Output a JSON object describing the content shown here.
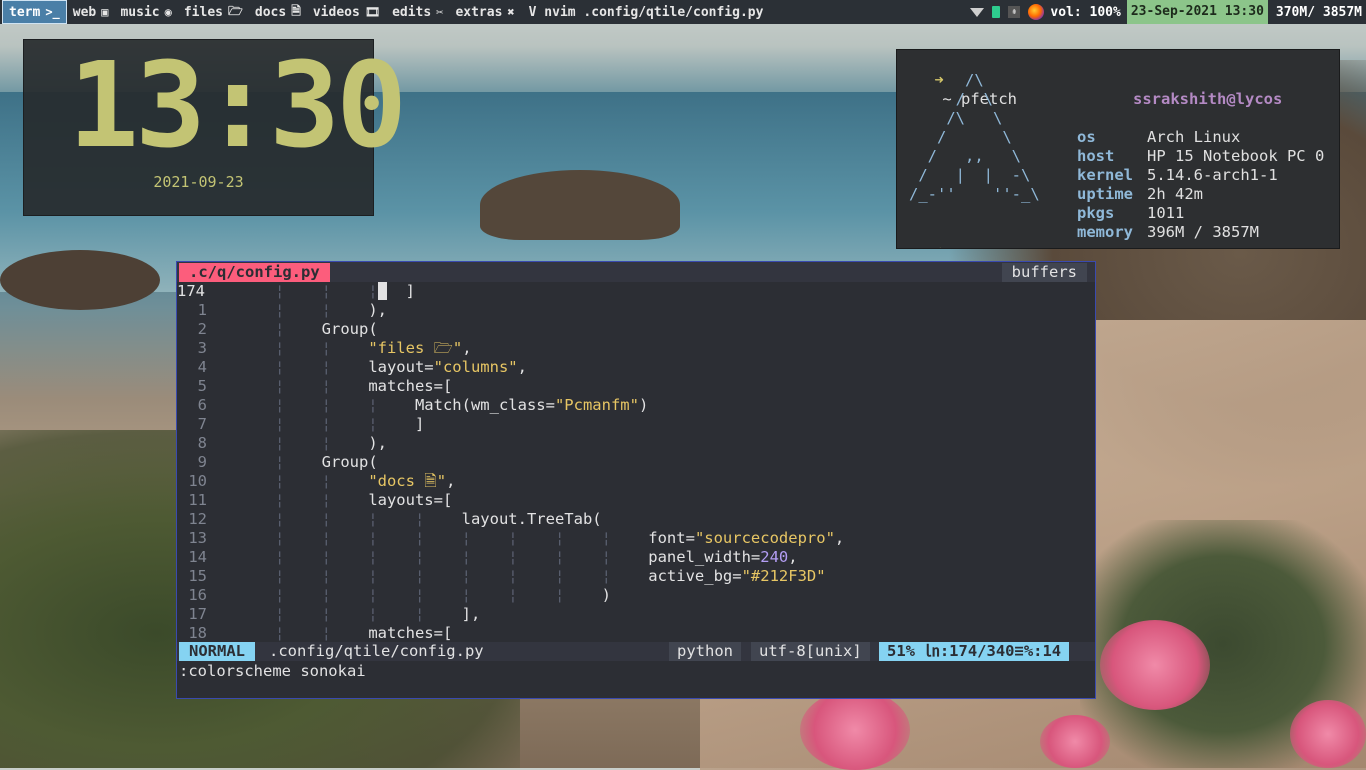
{
  "topbar": {
    "groups": [
      {
        "label": "term",
        "icon": ">_",
        "icon_name": "terminal-icon",
        "active": true
      },
      {
        "label": "web",
        "icon": "▣",
        "icon_name": "browser-icon"
      },
      {
        "label": "music",
        "icon": "◉",
        "icon_name": "music-icon"
      },
      {
        "label": "files",
        "icon": "🗁",
        "icon_name": "folder-icon"
      },
      {
        "label": "docs",
        "icon": "🗎",
        "icon_name": "document-icon"
      },
      {
        "label": "videos",
        "icon": "🎞",
        "icon_name": "film-icon"
      },
      {
        "label": "edits",
        "icon": "✂",
        "icon_name": "scissors-icon"
      },
      {
        "label": "extras",
        "icon": "✖",
        "icon_name": "tools-icon"
      }
    ],
    "window_title": "V nvim .config/qtile/config.py",
    "volume": "vol: 100%",
    "datetime": "23-Sep-2021 13:30",
    "memory": "370M/ 3857M",
    "update_icon": "⇞"
  },
  "clock": {
    "time": "13:30",
    "date": "2021-09-23"
  },
  "pfetch": {
    "prompt_arrow": "➜",
    "prompt": "~ pfetch",
    "prompt2": "~",
    "ascii": [
      "      /\\",
      "     /  \\",
      "    /\\   \\",
      "   /      \\",
      "  /   ,,   \\",
      " /   |  |  -\\",
      "/_-''    ''-_\\"
    ],
    "user": "ssrakshith@lycos",
    "info": [
      {
        "key": "os",
        "value": "Arch Linux"
      },
      {
        "key": "host",
        "value": "HP 15 Notebook PC 0"
      },
      {
        "key": "kernel",
        "value": "5.14.6-arch1-1"
      },
      {
        "key": "uptime",
        "value": "2h 42m"
      },
      {
        "key": "pkgs",
        "value": "1011"
      },
      {
        "key": "memory",
        "value": "396M / 3857M"
      }
    ]
  },
  "nvim": {
    "tab_label": ".c/q/config.py",
    "buffers_label": "buffers",
    "lines": [
      {
        "n": "174",
        "current": true,
        "segs": [
          {
            "t": "      ¦    ¦    ¦",
            "c": "guide"
          },
          {
            "t": " ",
            "c": "cursor"
          },
          {
            "t": "  ]",
            "c": ""
          }
        ]
      },
      {
        "n": "1",
        "segs": [
          {
            "t": "      ¦    ¦    ",
            "c": "guide"
          },
          {
            "t": "),",
            "c": ""
          }
        ]
      },
      {
        "n": "2",
        "segs": [
          {
            "t": "      ¦    ",
            "c": "guide"
          },
          {
            "t": "Group(",
            "c": ""
          }
        ]
      },
      {
        "n": "3",
        "segs": [
          {
            "t": "      ¦    ¦    ",
            "c": "guide"
          },
          {
            "t": "\"files 🗁\"",
            "c": "str"
          },
          {
            "t": ",",
            "c": ""
          }
        ]
      },
      {
        "n": "4",
        "segs": [
          {
            "t": "      ¦    ¦    ",
            "c": "guide"
          },
          {
            "t": "layout=",
            "c": ""
          },
          {
            "t": "\"columns\"",
            "c": "str"
          },
          {
            "t": ",",
            "c": ""
          }
        ]
      },
      {
        "n": "5",
        "segs": [
          {
            "t": "      ¦    ¦    ",
            "c": "guide"
          },
          {
            "t": "matches=[",
            "c": ""
          }
        ]
      },
      {
        "n": "6",
        "segs": [
          {
            "t": "      ¦    ¦    ¦    ",
            "c": "guide"
          },
          {
            "t": "Match(wm_class=",
            "c": ""
          },
          {
            "t": "\"Pcmanfm\"",
            "c": "str"
          },
          {
            "t": ")",
            "c": ""
          }
        ]
      },
      {
        "n": "7",
        "segs": [
          {
            "t": "      ¦    ¦    ¦    ",
            "c": "guide"
          },
          {
            "t": "]",
            "c": ""
          }
        ]
      },
      {
        "n": "8",
        "segs": [
          {
            "t": "      ¦    ¦    ",
            "c": "guide"
          },
          {
            "t": "),",
            "c": ""
          }
        ]
      },
      {
        "n": "9",
        "segs": [
          {
            "t": "      ¦    ",
            "c": "guide"
          },
          {
            "t": "Group(",
            "c": ""
          }
        ]
      },
      {
        "n": "10",
        "segs": [
          {
            "t": "      ¦    ¦    ",
            "c": "guide"
          },
          {
            "t": "\"docs 🗎\"",
            "c": "str"
          },
          {
            "t": ",",
            "c": ""
          }
        ]
      },
      {
        "n": "11",
        "segs": [
          {
            "t": "      ¦    ¦    ",
            "c": "guide"
          },
          {
            "t": "layouts=[",
            "c": ""
          }
        ]
      },
      {
        "n": "12",
        "segs": [
          {
            "t": "      ¦    ¦    ¦    ¦    ",
            "c": "guide"
          },
          {
            "t": "layout.TreeTab(",
            "c": ""
          }
        ]
      },
      {
        "n": "13",
        "segs": [
          {
            "t": "      ¦    ¦    ¦    ¦    ¦    ¦    ¦    ¦    ",
            "c": "guide"
          },
          {
            "t": "font=",
            "c": ""
          },
          {
            "t": "\"sourcecodepro\"",
            "c": "str"
          },
          {
            "t": ",",
            "c": ""
          }
        ]
      },
      {
        "n": "14",
        "segs": [
          {
            "t": "      ¦    ¦    ¦    ¦    ¦    ¦    ¦    ¦    ",
            "c": "guide"
          },
          {
            "t": "panel_width=",
            "c": ""
          },
          {
            "t": "240",
            "c": "num"
          },
          {
            "t": ",",
            "c": ""
          }
        ]
      },
      {
        "n": "15",
        "segs": [
          {
            "t": "      ¦    ¦    ¦    ¦    ¦    ¦    ¦    ¦    ",
            "c": "guide"
          },
          {
            "t": "active_bg=",
            "c": ""
          },
          {
            "t": "\"#212F3D\"",
            "c": "str"
          }
        ]
      },
      {
        "n": "16",
        "segs": [
          {
            "t": "      ¦    ¦    ¦    ¦    ¦    ¦    ¦    ",
            "c": "guide"
          },
          {
            "t": ")",
            "c": ""
          }
        ]
      },
      {
        "n": "17",
        "segs": [
          {
            "t": "      ¦    ¦    ¦    ¦    ",
            "c": "guide"
          },
          {
            "t": "],",
            "c": ""
          }
        ]
      },
      {
        "n": "18",
        "segs": [
          {
            "t": "      ¦    ¦    ",
            "c": "guide"
          },
          {
            "t": "matches=[",
            "c": ""
          }
        ]
      }
    ],
    "status": {
      "mode": "NORMAL",
      "file": ".config/qtile/config.py",
      "filetype": "python",
      "encoding": "utf-8[unix]",
      "position": "51% ㏑:174/340≡%:14"
    },
    "cmdline": ":colorscheme sonokai"
  },
  "colors": {
    "bar_bg": "#2b3036",
    "active_group": "#4a7fa7",
    "date_bg": "#8cc58a",
    "clock_fg": "#c3c474",
    "nvim_bg": "#2c2e34",
    "tab_active": "#fc5d7c",
    "mode_bg": "#85d3f2",
    "string": "#e7c664",
    "number": "#b39df3"
  }
}
